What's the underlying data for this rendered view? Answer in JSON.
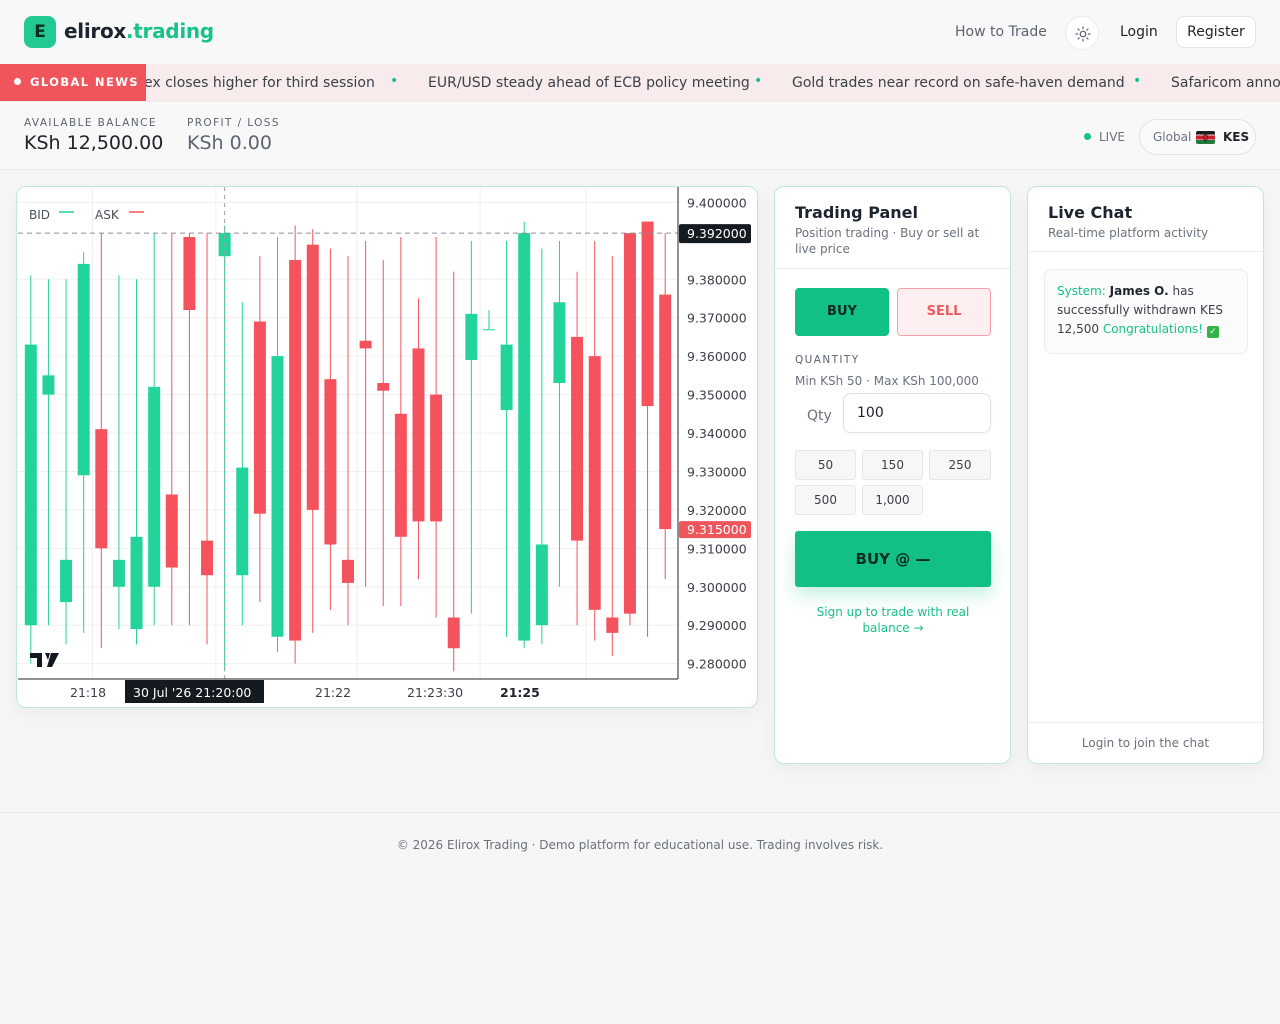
{
  "brand": {
    "badge": "E",
    "name_main": "elirox",
    "name_accent": ".trading",
    "accent_color": "#17c38a"
  },
  "nav": {
    "how_to_trade": "How to Trade",
    "theme_icon": "sun-icon",
    "login": "Login",
    "register": "Register"
  },
  "news": {
    "label": "GLOBAL NEWS",
    "items": [
      "ex closes higher for third session",
      "EUR/USD steady ahead of ECB policy meeting",
      "Gold trades near record on safe-haven demand",
      "Safaricom annou"
    ],
    "separator": "•"
  },
  "account": {
    "balance_label": "AVAILABLE BALANCE",
    "balance_value": "KSh 12,500.00",
    "pl_label": "PROFIT / LOSS",
    "pl_value": "KSh 0.00",
    "live_label": "LIVE",
    "region_label": "Global",
    "currency": "KES"
  },
  "chart_data": {
    "type": "candlestick",
    "legend": [
      "BID",
      "ASK"
    ],
    "up_color": "#22d39a",
    "down_color": "#f4535e",
    "y_ticks": [
      "9.400000",
      "9.380000",
      "9.370000",
      "9.360000",
      "9.350000",
      "9.340000",
      "9.330000",
      "9.320000",
      "9.310000",
      "9.300000",
      "9.290000",
      "9.280000"
    ],
    "ylim": [
      9.276,
      9.404
    ],
    "ask_price_label": "9.392000",
    "ask_price": 9.392,
    "bid_price_label": "9.315000",
    "bid_price": 9.315,
    "x_ticks": [
      "21:18",
      "21:22",
      "21:23:30",
      "21:25"
    ],
    "crosshair_label": "30 Jul '26   21:20:00",
    "candles": [
      {
        "open": 9.29,
        "close": 9.363,
        "high": 9.381,
        "low": 9.28
      },
      {
        "open": 9.35,
        "close": 9.355,
        "high": 9.38,
        "low": 9.29
      },
      {
        "open": 9.296,
        "close": 9.307,
        "high": 9.38,
        "low": 9.285
      },
      {
        "open": 9.329,
        "close": 9.384,
        "high": 9.387,
        "low": 9.288
      },
      {
        "open": 9.341,
        "close": 9.31,
        "high": 9.392,
        "low": 9.284
      },
      {
        "open": 9.3,
        "close": 9.307,
        "high": 9.381,
        "low": 9.289
      },
      {
        "open": 9.289,
        "close": 9.313,
        "high": 9.38,
        "low": 9.285
      },
      {
        "open": 9.3,
        "close": 9.352,
        "high": 9.392,
        "low": 9.29
      },
      {
        "open": 9.324,
        "close": 9.305,
        "high": 9.392,
        "low": 9.29
      },
      {
        "open": 9.391,
        "close": 9.372,
        "high": 9.392,
        "low": 9.29
      },
      {
        "open": 9.312,
        "close": 9.303,
        "high": 9.392,
        "low": 9.285
      },
      {
        "open": 9.386,
        "close": 9.392,
        "high": 9.394,
        "low": 9.278
      },
      {
        "open": 9.303,
        "close": 9.331,
        "high": 9.374,
        "low": 9.29
      },
      {
        "open": 9.369,
        "close": 9.319,
        "high": 9.386,
        "low": 9.296
      },
      {
        "open": 9.287,
        "close": 9.36,
        "high": 9.391,
        "low": 9.283
      },
      {
        "open": 9.385,
        "close": 9.286,
        "high": 9.394,
        "low": 9.28
      },
      {
        "open": 9.389,
        "close": 9.32,
        "high": 9.393,
        "low": 9.288
      },
      {
        "open": 9.354,
        "close": 9.311,
        "high": 9.388,
        "low": 9.294
      },
      {
        "open": 9.307,
        "close": 9.301,
        "high": 9.386,
        "low": 9.29
      },
      {
        "open": 9.364,
        "close": 9.362,
        "high": 9.39,
        "low": 9.3
      },
      {
        "open": 9.353,
        "close": 9.351,
        "high": 9.385,
        "low": 9.295
      },
      {
        "open": 9.345,
        "close": 9.313,
        "high": 9.391,
        "low": 9.295
      },
      {
        "open": 9.362,
        "close": 9.317,
        "high": 9.375,
        "low": 9.302
      },
      {
        "open": 9.35,
        "close": 9.317,
        "high": 9.391,
        "low": 9.292
      },
      {
        "open": 9.292,
        "close": 9.284,
        "high": 9.382,
        "low": 9.278
      },
      {
        "open": 9.359,
        "close": 9.371,
        "high": 9.39,
        "low": 9.293
      },
      {
        "open": 9.367,
        "close": 9.367,
        "high": 9.372,
        "low": 9.367
      },
      {
        "open": 9.346,
        "close": 9.363,
        "high": 9.39,
        "low": 9.287
      },
      {
        "open": 9.286,
        "close": 9.392,
        "high": 9.395,
        "low": 9.284
      },
      {
        "open": 9.29,
        "close": 9.311,
        "high": 9.388,
        "low": 9.285
      },
      {
        "open": 9.353,
        "close": 9.374,
        "high": 9.39,
        "low": 9.3
      },
      {
        "open": 9.365,
        "close": 9.312,
        "high": 9.382,
        "low": 9.29
      },
      {
        "open": 9.36,
        "close": 9.294,
        "high": 9.39,
        "low": 9.286
      },
      {
        "open": 9.292,
        "close": 9.288,
        "high": 9.386,
        "low": 9.282
      },
      {
        "open": 9.392,
        "close": 9.293,
        "high": 9.392,
        "low": 9.29
      },
      {
        "open": 9.395,
        "close": 9.347,
        "high": 9.395,
        "low": 9.287
      },
      {
        "open": 9.376,
        "close": 9.315,
        "high": 9.392,
        "low": 9.302
      }
    ]
  },
  "trading_panel": {
    "title": "Trading Panel",
    "subtitle": "Position trading · Buy or sell at live price",
    "buy_label": "BUY",
    "sell_label": "SELL",
    "quantity_label": "QUANTITY",
    "quantity_range": "Min KSh 50 · Max KSh 100,000",
    "qty_prefix": "Qty",
    "qty_value": "100",
    "presets": [
      "50",
      "150",
      "250",
      "500",
      "1,000"
    ],
    "action_label": "BUY @ —",
    "signup_text": "Sign up to trade with real balance →"
  },
  "chat": {
    "title": "Live Chat",
    "subtitle": "Real-time platform activity",
    "message": {
      "system_label": "System:",
      "user": "James O.",
      "text": "has successfully withdrawn KES 12,500",
      "congrats": "Congratulations!",
      "emoji_icon": "check-mark-icon"
    },
    "footer": "Login to join the chat"
  },
  "footer": {
    "text": "© 2026 Elirox Trading · Demo platform for educational use. Trading involves risk."
  }
}
